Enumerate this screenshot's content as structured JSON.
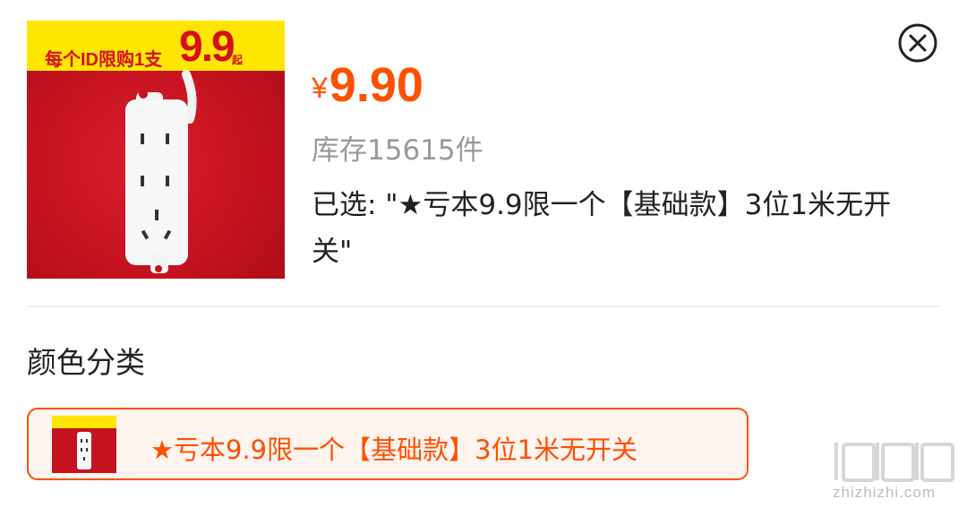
{
  "product": {
    "image": {
      "promo_text": "每个ID限购1支",
      "promo_price": "9.9",
      "promo_suffix": "起"
    },
    "price_symbol": "¥",
    "price_value": "9.90",
    "stock_text": "库存15615件",
    "selected_text": "已选: \"★亏本9.9限一个【基础款】3位1米无开关\""
  },
  "close_icon": "close-circle-icon",
  "section": {
    "title": "颜色分类"
  },
  "sku_options": [
    {
      "label": "★亏本9.9限一个【基础款】3位1米无开关",
      "selected": true
    }
  ],
  "watermark": {
    "text": "zhizhizhi.com",
    "logo": "值值值"
  },
  "colors": {
    "accent": "#ff5000",
    "promo_red": "#c4121f",
    "promo_yellow": "#ffe600",
    "muted_text": "#999999"
  }
}
